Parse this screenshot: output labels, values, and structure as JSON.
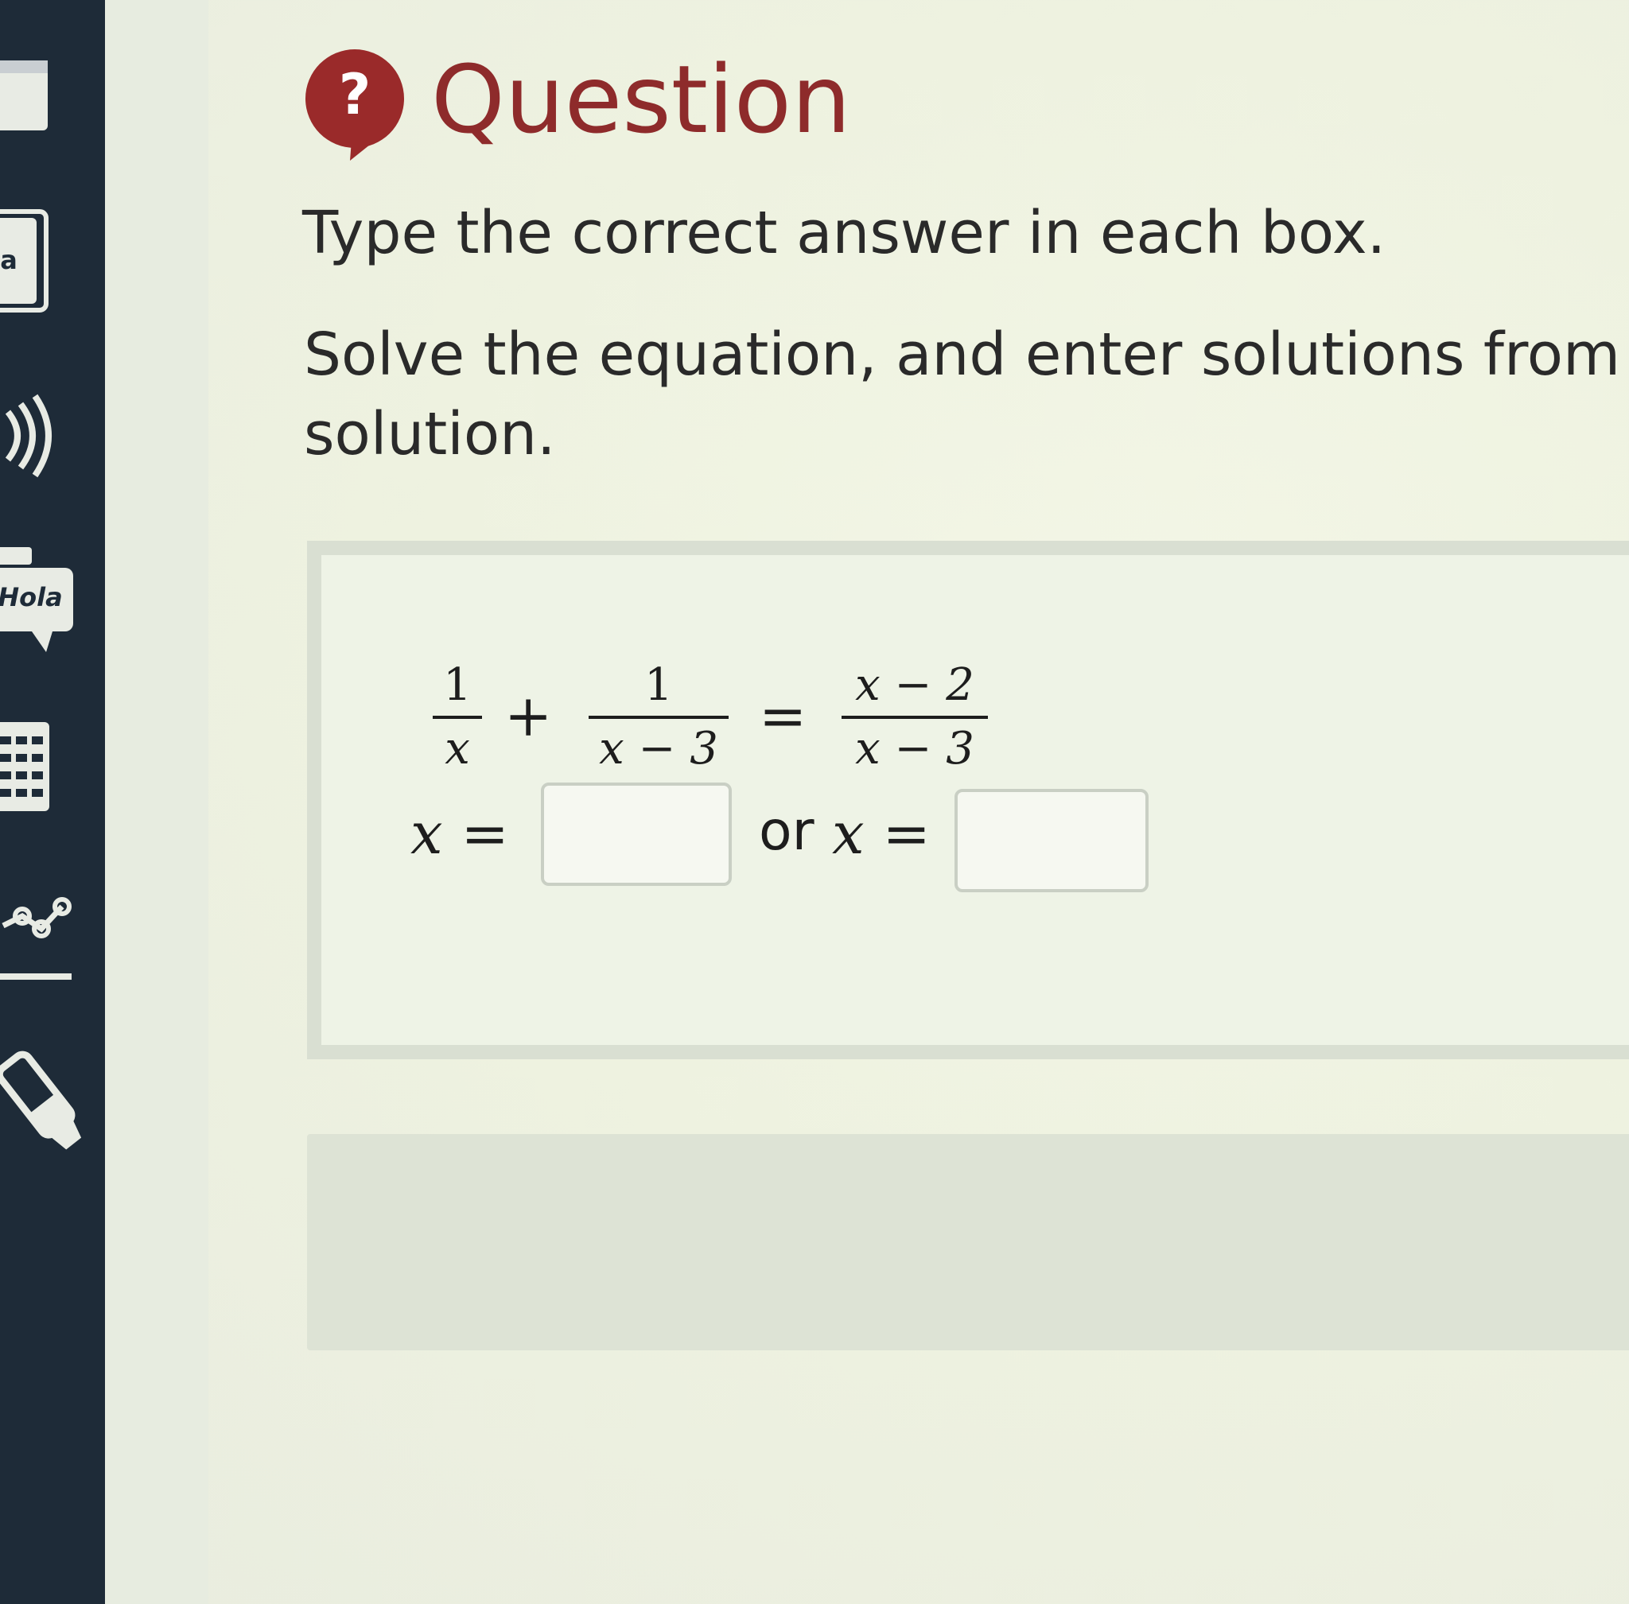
{
  "header": {
    "badge_symbol": "?",
    "title": "Question",
    "title_color": "#8e2b2b"
  },
  "instruction": "Type the correct answer in each box.",
  "directions": {
    "line1": "Solve the equation, and enter solutions from le",
    "line2": "solution."
  },
  "toolbar": {
    "translate_label": "a",
    "dictionary_label": "Hola",
    "icons": [
      "notepad-icon",
      "translate-icon",
      "audio-icon",
      "dictionary-icon",
      "calculator-icon",
      "graph-icon",
      "highlighter-icon"
    ]
  },
  "equation": {
    "term1": {
      "num": "1",
      "den": "x"
    },
    "plus": "+",
    "term2": {
      "num": "1",
      "den": "x − 3"
    },
    "equals": "=",
    "term3": {
      "num": "x − 2",
      "den": "x − 3"
    }
  },
  "answers": {
    "lhs1": "x =",
    "connector": "or",
    "lhs2": "x =",
    "box1_value": "",
    "box2_value": ""
  },
  "colors": {
    "rail": "#1e2b38",
    "badge": "#9a2a2a"
  }
}
